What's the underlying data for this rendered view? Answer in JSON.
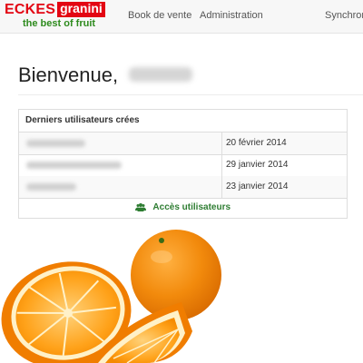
{
  "brand": {
    "word1": "ECKES",
    "word2": "granini",
    "tagline": "the best of fruit"
  },
  "nav": {
    "items": [
      {
        "label": "Book de vente"
      },
      {
        "label": "Administration"
      },
      {
        "label": "Synchron"
      }
    ]
  },
  "page": {
    "title": "Bienvenue,"
  },
  "recent_users": {
    "heading": "Derniers utilisateurs crées",
    "rows": [
      {
        "date": "20 février 2014"
      },
      {
        "date": "29 janvier 2014"
      },
      {
        "date": "23 janvier 2014"
      }
    ],
    "footer_link": "Accès utilisateurs",
    "footer_icon": "users-icon"
  },
  "colors": {
    "brand_red": "#e30613",
    "brand_green": "#2e8b1e",
    "link_green": "#2e7d32"
  }
}
